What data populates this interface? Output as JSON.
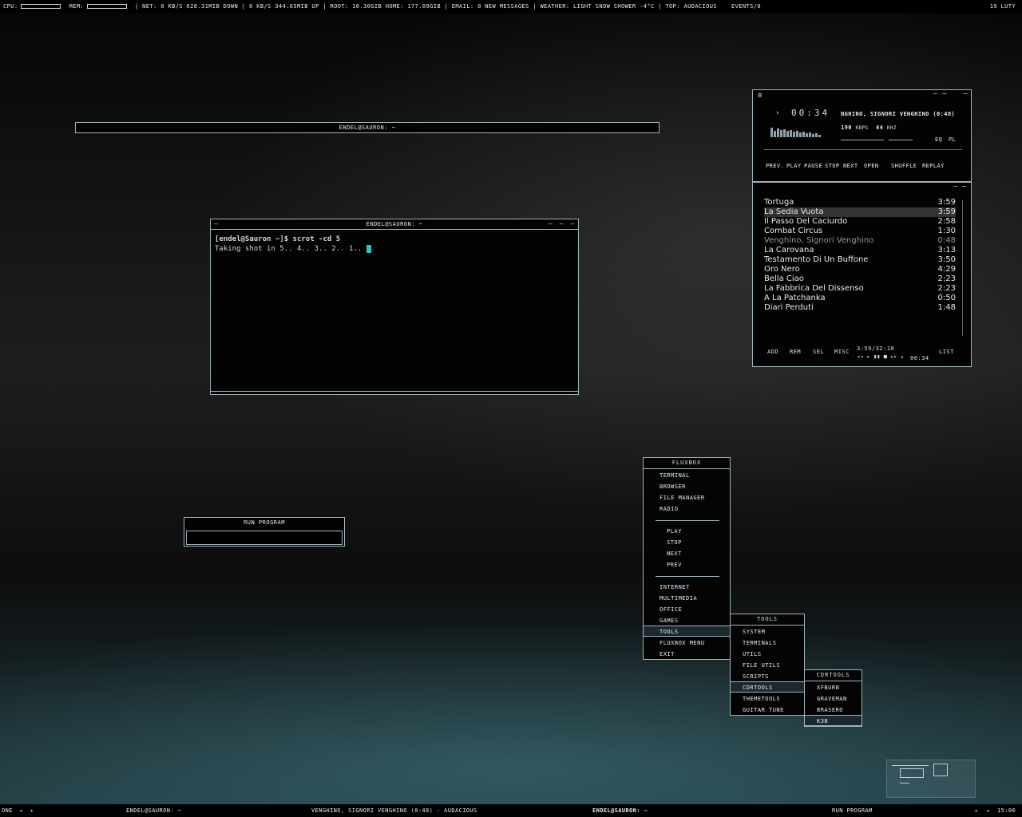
{
  "topbar": {
    "cpu_label": "cpu:",
    "mem_label": "mem:",
    "net": "| net:  0 kb/s  628.31mib down  |  0 kb/s  344.65mib up  |  root:  10.30gib  home:  177.09gib  |  email:  0 new messages  |  weather:  light snow shower -4°c  |  top:  audacious",
    "events": "events/0",
    "date": "19 luty"
  },
  "wide_window": {
    "title": "endel@sauron: ~"
  },
  "terminal": {
    "title": "endel@sauron: ~",
    "line1": "[endel@Sauron ~]$ scrot -cd 5",
    "line2": "Taking shot in 5.. 4.. 3.. 2.. 1.. "
  },
  "run_program": {
    "title": "run program"
  },
  "audacious": {
    "time": "00:34",
    "song_title": "nghino, signori venghino (0:48)",
    "kbps": "190",
    "kbps_unit": "kbps",
    "khz": "44",
    "khz_unit": "khz",
    "eq": "eq",
    "pl": "pl",
    "controls": [
      "prev.",
      "play",
      "pause",
      "stop",
      "next",
      "open",
      "shuffle",
      "replay"
    ],
    "playlist": [
      {
        "title": "Tortuga",
        "dur": "3:59"
      },
      {
        "title": "La Sedia Vuota",
        "dur": "3:59"
      },
      {
        "title": "Il Passo Del Caciurdo",
        "dur": "2:58"
      },
      {
        "title": "Combat Circus",
        "dur": "1:30"
      },
      {
        "title": "Venghino, Signori Venghino",
        "dur": "0:48"
      },
      {
        "title": "La Carovana",
        "dur": "3:13"
      },
      {
        "title": "Testamento Di Un Buffone",
        "dur": "3:50"
      },
      {
        "title": "Oro Nero",
        "dur": "4:29"
      },
      {
        "title": "Bella Ciao",
        "dur": "2:23"
      },
      {
        "title": "La Fabbrica Del Dissenso",
        "dur": "2:23"
      },
      {
        "title": "A La Patchanka",
        "dur": "0:50"
      },
      {
        "title": "Diari Perduti",
        "dur": "1:48"
      }
    ],
    "pl_buttons": [
      "add",
      "rem",
      "sel",
      "misc"
    ],
    "total_time": "3:59/32:10",
    "elapsed": "00:34",
    "list_label": "list"
  },
  "menu_main": {
    "title": "fluxbox",
    "group1": [
      "terminal",
      "browser",
      "file manager",
      "radio"
    ],
    "group2": [
      "play",
      "stop",
      "next",
      "prev"
    ],
    "group3": [
      "internet",
      "multimedia",
      "office",
      "games",
      "tools",
      "fluxbox menu",
      "exit"
    ]
  },
  "menu_tools": {
    "title": "tools",
    "items": [
      "system",
      "terminals",
      "utils",
      "file utils",
      "scripts",
      "cdrtools",
      "themetools",
      "guitar tune"
    ]
  },
  "menu_cdr": {
    "title": "cdrtools",
    "items": [
      "xfburn",
      "graveman",
      "brasero",
      "k3b"
    ]
  },
  "bottombar": {
    "workspace": "one",
    "task1": "endel@sauron: ~",
    "task2": "venghino, signori venghino (0:48) - audacious",
    "task3": "endel@sauron: ~",
    "task4": "run program",
    "clock": "15:06"
  }
}
